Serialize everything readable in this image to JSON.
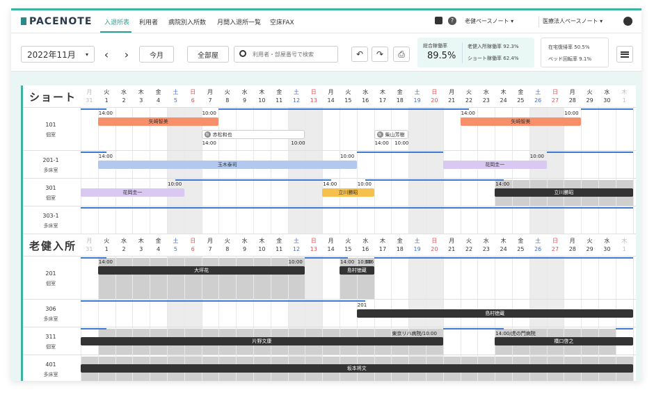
{
  "app": {
    "logo": "PACENOTE"
  },
  "nav": {
    "tabs": [
      "入退所表",
      "利用者",
      "病院別入所数",
      "月間入退所一覧",
      "空床FAX"
    ],
    "facility_select": "老健ペースノート",
    "org_select": "医療法人ペースノート"
  },
  "toolbar": {
    "month": "2022年11月",
    "prev": "‹",
    "next": "›",
    "today": "今月",
    "all_rooms": "全部屋",
    "search_placeholder": "利用者・部屋番号で検索",
    "undo": "↶",
    "redo": "↷",
    "print": "⎙",
    "stats": {
      "total_label": "総合稼働率",
      "total_value": "89.5%",
      "roken_label": "老健入所稼働率",
      "roken_value": "92.3%",
      "short_label": "ショート稼働率",
      "short_value": "62.4%",
      "home_label": "在宅復帰率",
      "home_value": "50.5%",
      "bed_label": "ベッド回転率",
      "bed_value": "9.1%"
    }
  },
  "days": [
    {
      "w": "月",
      "d": "31",
      "t": "out"
    },
    {
      "w": "火",
      "d": "1",
      "t": ""
    },
    {
      "w": "水",
      "d": "2",
      "t": ""
    },
    {
      "w": "木",
      "d": "3",
      "t": ""
    },
    {
      "w": "金",
      "d": "4",
      "t": ""
    },
    {
      "w": "土",
      "d": "5",
      "t": "sat"
    },
    {
      "w": "日",
      "d": "6",
      "t": "sun"
    },
    {
      "w": "月",
      "d": "7",
      "t": ""
    },
    {
      "w": "火",
      "d": "8",
      "t": ""
    },
    {
      "w": "水",
      "d": "9",
      "t": ""
    },
    {
      "w": "木",
      "d": "10",
      "t": ""
    },
    {
      "w": "金",
      "d": "11",
      "t": ""
    },
    {
      "w": "土",
      "d": "12",
      "t": "sat"
    },
    {
      "w": "日",
      "d": "13",
      "t": "sun"
    },
    {
      "w": "月",
      "d": "14",
      "t": ""
    },
    {
      "w": "火",
      "d": "15",
      "t": ""
    },
    {
      "w": "水",
      "d": "16",
      "t": ""
    },
    {
      "w": "木",
      "d": "17",
      "t": ""
    },
    {
      "w": "金",
      "d": "18",
      "t": ""
    },
    {
      "w": "土",
      "d": "19",
      "t": "sat"
    },
    {
      "w": "日",
      "d": "20",
      "t": "sun"
    },
    {
      "w": "月",
      "d": "21",
      "t": ""
    },
    {
      "w": "火",
      "d": "22",
      "t": ""
    },
    {
      "w": "水",
      "d": "23",
      "t": ""
    },
    {
      "w": "木",
      "d": "24",
      "t": ""
    },
    {
      "w": "金",
      "d": "25",
      "t": ""
    },
    {
      "w": "土",
      "d": "26",
      "t": "sat"
    },
    {
      "w": "日",
      "d": "27",
      "t": "sun"
    },
    {
      "w": "月",
      "d": "28",
      "t": ""
    },
    {
      "w": "火",
      "d": "29",
      "t": ""
    },
    {
      "w": "水",
      "d": "30",
      "t": ""
    },
    {
      "w": "木",
      "d": "1",
      "t": "out"
    }
  ],
  "sections": [
    {
      "title": "ショート",
      "rooms": [
        {
          "num": "101",
          "type": "個室"
        },
        {
          "num": "201-1",
          "type": "多床室"
        },
        {
          "num": "301",
          "type": "個室"
        },
        {
          "num": "303-1",
          "type": "多床室"
        }
      ]
    },
    {
      "title": "老健入所",
      "rooms": [
        {
          "num": "201",
          "type": "個室"
        },
        {
          "num": "306",
          "type": "多床室"
        },
        {
          "num": "311",
          "type": "個室"
        },
        {
          "num": "401",
          "type": "多床室"
        }
      ]
    }
  ],
  "bars": [
    {
      "name": "矢崎智美",
      "s": 1,
      "e": 8,
      "row": "s0",
      "bg": "#f7906a",
      "fg": "#333"
    },
    {
      "name": "矢崎智美",
      "s": 22,
      "e": 29,
      "row": "s0",
      "bg": "#f7906a",
      "fg": "#333"
    },
    {
      "name": "玉木泰司",
      "s": 1,
      "e": 16,
      "row": "s1",
      "bg": "#b3c8ef",
      "fg": "#333"
    },
    {
      "name": "花岡圭一",
      "s": 21,
      "e": 27,
      "row": "s1",
      "bg": "#d8c8f2",
      "fg": "#333"
    },
    {
      "name": "花岡圭一",
      "s": 0,
      "e": 6,
      "row": "s2",
      "bg": "#d8c8f2",
      "fg": "#333"
    },
    {
      "name": "立川勝昭",
      "s": 14,
      "e": 17,
      "row": "s2",
      "bg": "#f6c04c",
      "fg": "#333"
    },
    {
      "name": "立川勝昭",
      "s": 24,
      "e": 32,
      "row": "s2",
      "bg": "#333333",
      "fg": "#fff"
    },
    {
      "name": "大坪花",
      "s": 1,
      "e": 13,
      "row": "r0",
      "bg": "#333333",
      "fg": "#fff"
    },
    {
      "name": "島村徳蔵",
      "s": 15,
      "e": 17,
      "row": "r0",
      "bg": "#333333",
      "fg": "#fff"
    },
    {
      "name": "島村徳蔵",
      "s": 16,
      "e": 32,
      "row": "r1",
      "bg": "#333333",
      "fg": "#fff"
    },
    {
      "name": "片野文康",
      "s": 0,
      "e": 21,
      "row": "r2",
      "bg": "#333333",
      "fg": "#fff"
    },
    {
      "name": "橋口啓之",
      "s": 24,
      "e": 32,
      "row": "r2",
      "bg": "#333333",
      "fg": "#fff"
    },
    {
      "name": "坂本将文",
      "s": 0,
      "e": 32,
      "row": "r3",
      "bg": "#333333",
      "fg": "#fff"
    }
  ],
  "times": [
    {
      "t": "14:00",
      "d": 1,
      "row": "s0"
    },
    {
      "t": "10:00",
      "d": 7,
      "row": "s0"
    },
    {
      "t": "14:00",
      "d": 22,
      "row": "s0"
    },
    {
      "t": "10:00",
      "d": 28,
      "row": "s0"
    },
    {
      "t": "14:00",
      "d": 1,
      "row": "s1"
    },
    {
      "t": "10:00",
      "d": 15,
      "row": "s1"
    },
    {
      "t": "10:00",
      "d": 26,
      "row": "s1"
    },
    {
      "t": "10:00",
      "d": 5,
      "row": "s2"
    },
    {
      "t": "14:00",
      "d": 14,
      "row": "s2"
    },
    {
      "t": "10:00",
      "d": 16,
      "row": "s2"
    },
    {
      "t": "14:00",
      "d": 24,
      "row": "s2"
    },
    {
      "t": "14:00",
      "d": 1,
      "row": "r0"
    },
    {
      "t": "10:00",
      "d": 12,
      "row": "r0"
    },
    {
      "t": "14:00",
      "d": 15,
      "row": "r0"
    },
    {
      "t": "10:00",
      "d": 16,
      "row": "r0"
    },
    {
      "t": "306",
      "d": 16.4,
      "row": "r0"
    },
    {
      "t": "201",
      "d": 16,
      "row": "r1"
    },
    {
      "t": "東京リハ病院/10:00",
      "d": 18,
      "row": "r2"
    },
    {
      "t": "14:00/虎の門病院",
      "d": 24,
      "row": "r2"
    }
  ],
  "cards": [
    {
      "name": "赤松和也",
      "badge": "仮",
      "s": 7,
      "e": 13,
      "row": "s0",
      "t1": "14:00",
      "t2": "10:00"
    },
    {
      "name": "柴山芳樹",
      "badge": "仮",
      "s": 17,
      "e": 19,
      "row": "s0",
      "t1": "14:00",
      "t2": "10:00"
    }
  ]
}
